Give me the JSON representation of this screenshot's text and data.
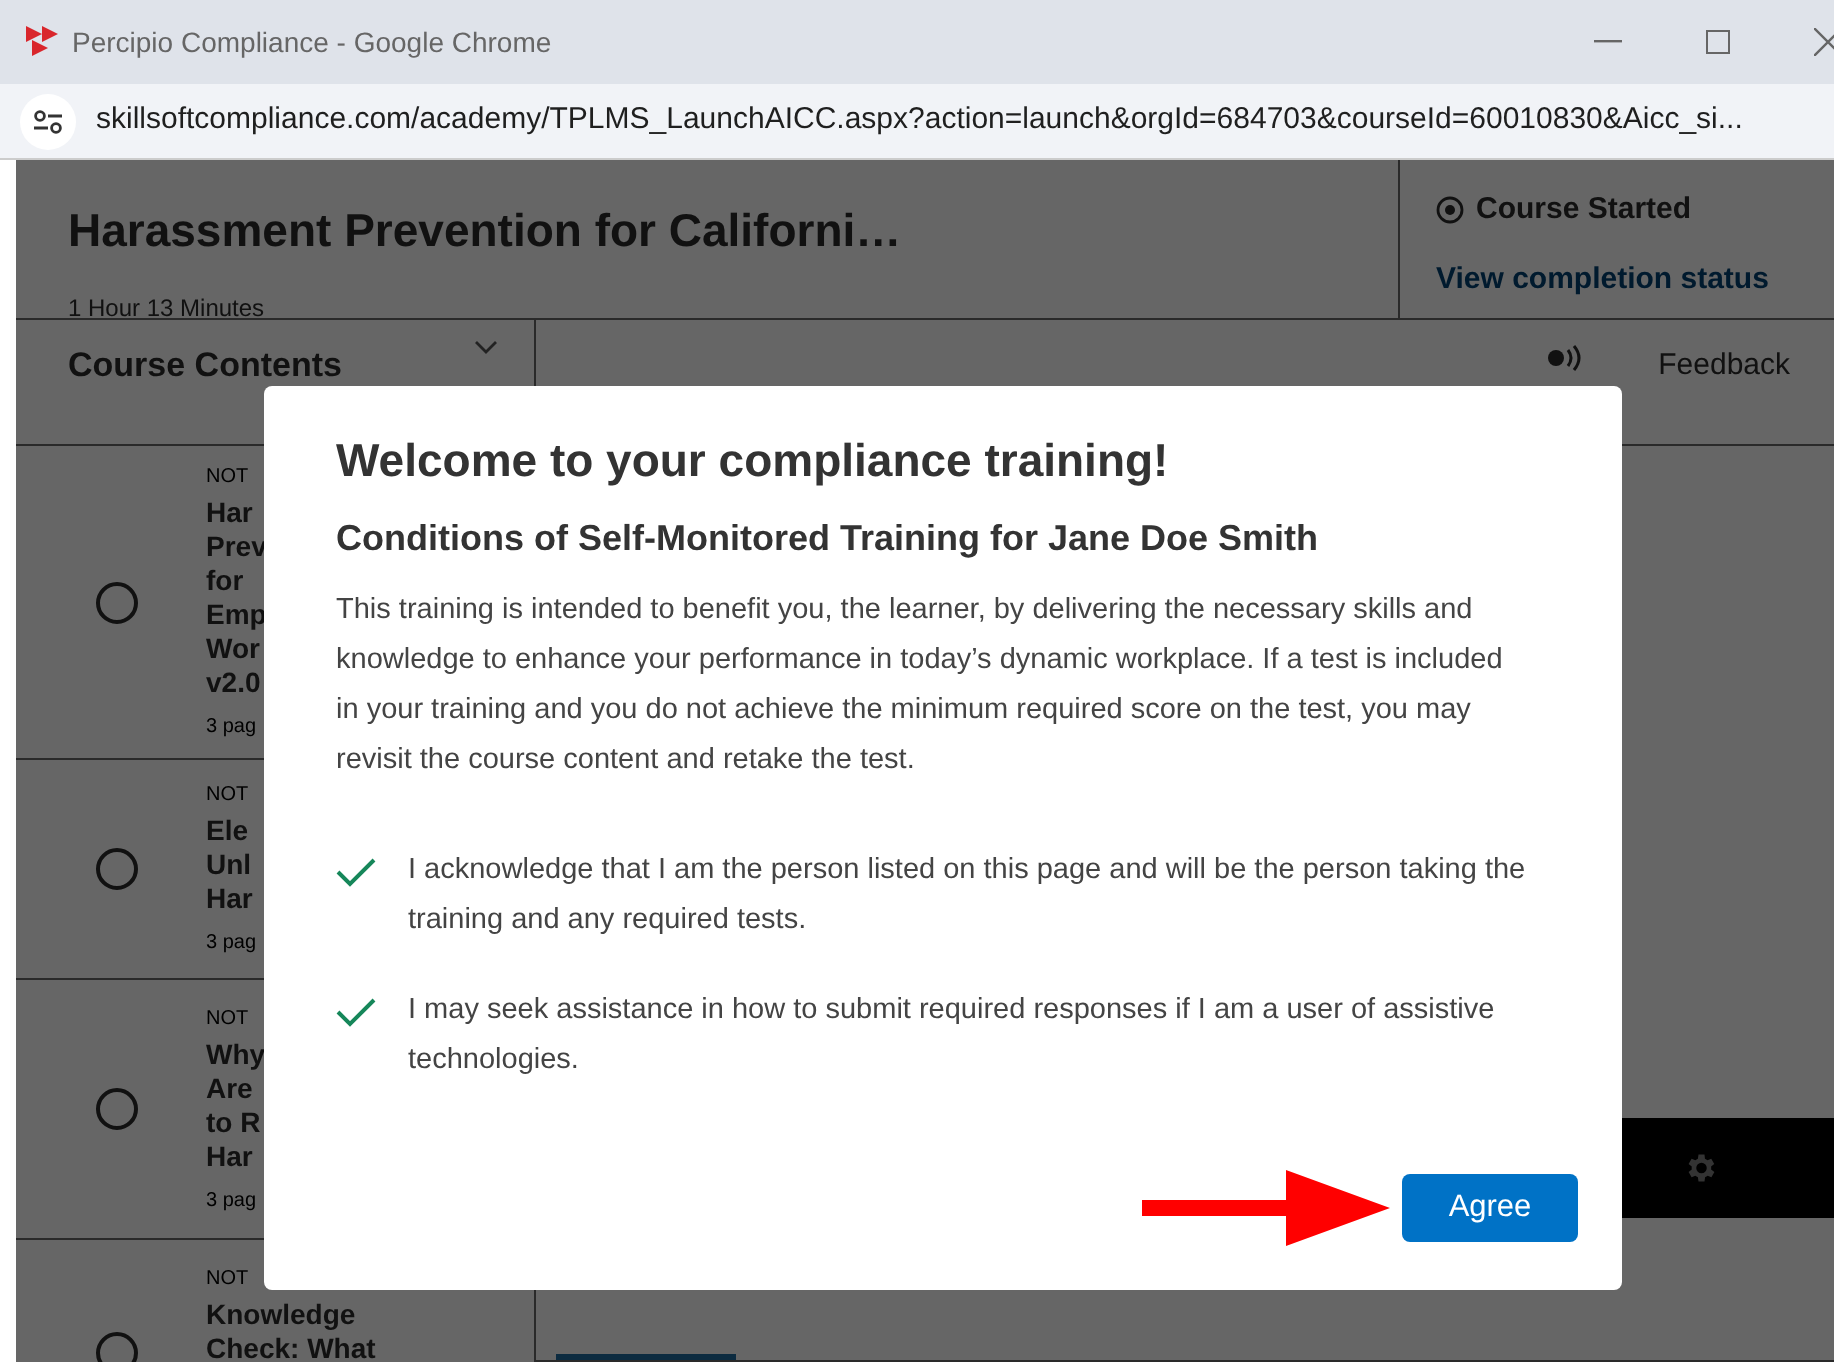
{
  "window": {
    "title": "Percipio Compliance - Google Chrome"
  },
  "address_bar": {
    "url": "skillsoftcompliance.com/academy/TPLMS_LaunchAICC.aspx?action=launch&orgId=684703&courseId=60010830&Aicc_si..."
  },
  "course_header": {
    "title": "Harassment Prevention for Californi…",
    "duration": "1 Hour 13 Minutes",
    "status": "Course Started",
    "completion_link": "View completion status"
  },
  "sidebar": {
    "title": "Course Contents",
    "items": [
      {
        "status": "NOT",
        "title": "Har\nPrev\nfor\nEmp\nWor\nv2.0",
        "meta": "3 pag",
        "completed": false
      },
      {
        "status": "NOT",
        "title": "Ele\nUnl\nHar",
        "meta": "3 pag",
        "completed": false
      },
      {
        "status": "NOT",
        "title": "Why\nAre\nto R\nHar",
        "meta": "3 pag",
        "completed": false
      },
      {
        "status": "NOT",
        "title": "Knowledge\nCheck: What",
        "completed": false
      }
    ]
  },
  "feedback": {
    "label": "Feedback"
  },
  "dialog": {
    "title": "Welcome to your compliance training!",
    "subtitle": "Conditions of Self-Monitored Training for Jane Doe Smith",
    "body": "This training is intended to benefit you, the learner, by delivering the necessary skills and knowledge to enhance your performance in today’s dynamic workplace. If a test is included in your training and you do not achieve the minimum required score on the test, you may revisit the course content and retake the test.",
    "conditions": [
      {
        "text": "I acknowledge that I am the person listed on this page and will be the person taking the training and any required tests.",
        "checked": true
      },
      {
        "text": "I may seek assistance in how to submit required responses if I am a user of assistive technologies.",
        "checked": true
      }
    ],
    "primary_button": "Agree"
  }
}
